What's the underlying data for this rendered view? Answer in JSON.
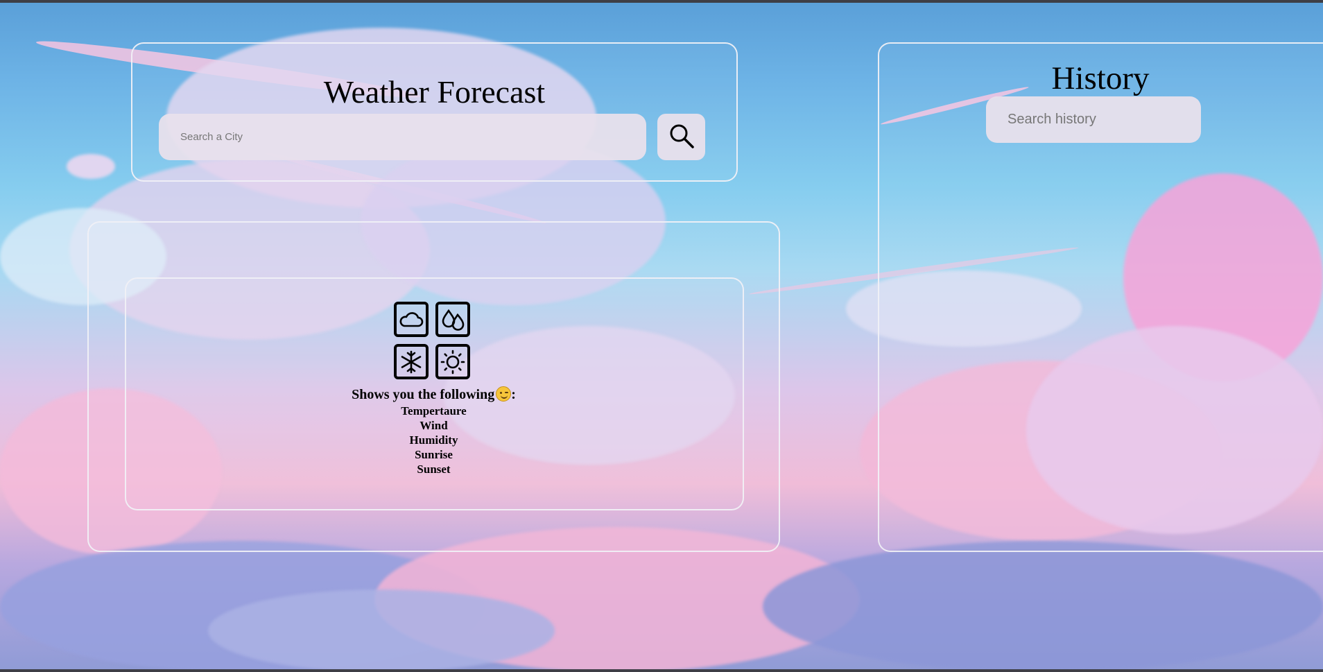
{
  "app": {
    "title": "Weather Forecast"
  },
  "search": {
    "placeholder": "Search a City",
    "button_icon": "search-icon"
  },
  "history": {
    "title": "History",
    "placeholder": "Search history"
  },
  "info": {
    "icons": [
      "cloud-icon",
      "droplets-icon",
      "snowflake-icon",
      "sun-icon"
    ],
    "heading": "Shows you the following",
    "heading_suffix": ":",
    "emoji": "winking-smile-emoji",
    "items": [
      "Tempertaure",
      "Wind",
      "Humidity",
      "Sunrise",
      "Sunset"
    ]
  },
  "colors": {
    "panel_border": "#f0f0f5",
    "input_background": "#e8e0ec",
    "sky_top": "#5a9fd8",
    "cloud_pink": "#f0bcd8"
  }
}
